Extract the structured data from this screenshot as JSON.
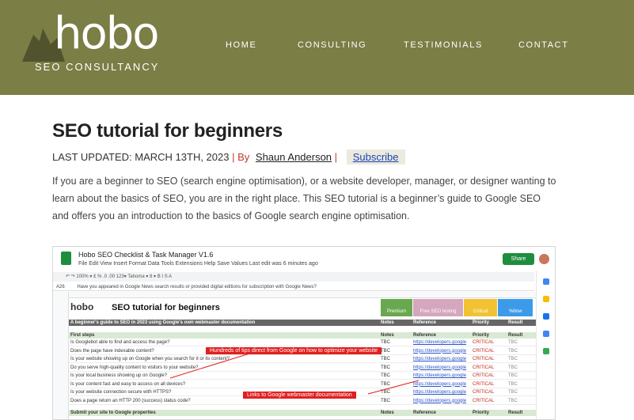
{
  "header": {
    "logo_text": "hobo",
    "tagline": "SEO CONSULTANCY",
    "bg_color": "#7b7e45",
    "nav": [
      {
        "label": "HOME"
      },
      {
        "label": "CONSULTING"
      },
      {
        "label": "TESTIMONIALS"
      },
      {
        "label": "CONTACT"
      }
    ]
  },
  "article": {
    "title": "SEO tutorial for beginners",
    "updated_label": "LAST UPDATED: MARCH 13TH, 2023",
    "by_text": "| By",
    "author": "Shaun Anderson",
    "pipe": "|",
    "subscribe_label": "Subscribe",
    "intro": "If you are a beginner to SEO (search engine optimisation), or a website developer, manager, or designer wanting to learn about the basics of SEO, you are in the right place. This SEO tutorial is a beginner’s guide to Google SEO and offers you an introduction to the basics of Google search engine optimisation."
  },
  "sheet": {
    "doc_name": "Hobo SEO Checklist & Task Manager V1.6",
    "menu": "File  Edit  View  Insert  Format  Data  Tools  Extensions  Help  Save Values   Last edit was 6 minutes ago",
    "share_label": "Share",
    "toolbar": "↶  ↷  100%  ▾  £  %  .0  .00  123▾   Tahoma  ▾   8  ▾   B  I  S  A",
    "cell_ref": "A26",
    "formula": "Have you appeared in Google News search results or provided digital editions for subscription with Google News?",
    "logo_text": "hobo",
    "big_title": "SEO tutorial for beginners",
    "header_cols": [
      {
        "label": "Premium",
        "color": "#6aa84f"
      },
      {
        "label": "Free SEO testing",
        "color": "#d5a6bd"
      },
      {
        "label": "Critical",
        "color": "#f1c232"
      },
      {
        "label": "Yellow",
        "color": "#3c9be8"
      }
    ],
    "guide_band": "A beginner's guide to SEO in 2023 using Google's own webmaster documentation",
    "band_cols": {
      "notes": "Notes",
      "reference": "Reference",
      "priority": "Priority",
      "result": "Result"
    },
    "first_steps": "First steps",
    "rows": [
      {
        "task": "Is Googlebot able to find and access the page?",
        "notes": "TBC",
        "ref": "https://developers.google",
        "priority": "CRITICAL",
        "result": "TBC"
      },
      {
        "task": "Does the page have indexable content?",
        "notes": "TBC",
        "ref": "https://developers.google",
        "priority": "CRITICAL",
        "result": "TBC"
      },
      {
        "task": "Is your website showing up on Google when you search for it or its content?",
        "notes": "TBC",
        "ref": "https://developers.google",
        "priority": "CRITICAL",
        "result": "TBC"
      },
      {
        "task": "Do you serve high-quality content to visitors to your website?",
        "notes": "TBC",
        "ref": "https://developers.google",
        "priority": "CRITICAL",
        "result": "TBC"
      },
      {
        "task": "Is your local business showing up on Google?",
        "notes": "TBC",
        "ref": "https://developers.google",
        "priority": "CRITICAL",
        "result": "TBC"
      },
      {
        "task": "Is your content fast and easy to access on all devices?",
        "notes": "TBC",
        "ref": "https://developers.google",
        "priority": "CRITICAL",
        "result": "TBC"
      },
      {
        "task": "Is your website connection secure with HTTPS?",
        "notes": "TBC",
        "ref": "https://developers.google",
        "priority": "CRITICAL",
        "result": "TBC"
      },
      {
        "task": "Does a page return an HTTP 200 (success) status code?",
        "notes": "TBC",
        "ref": "https://developers.google",
        "priority": "CRITICAL",
        "result": "TBC"
      }
    ],
    "submit_band": "Submit your site to Google properties",
    "callout_1": "Hundreds of tips direct from Google on how to optimize your website",
    "callout_2": "Links to Google webmaster documentation"
  }
}
